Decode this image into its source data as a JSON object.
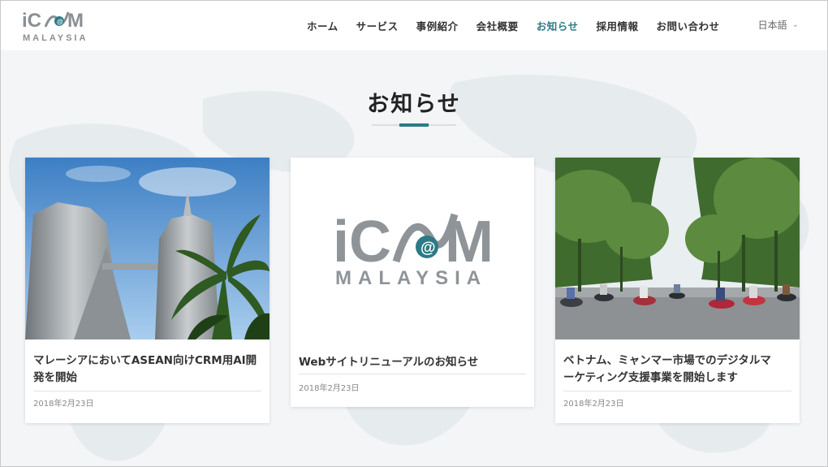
{
  "header": {
    "logo_text_top": "iC@M",
    "logo_text_bottom": "MALAYSIA",
    "nav": [
      {
        "label": "ホーム",
        "active": false
      },
      {
        "label": "サービス",
        "active": false
      },
      {
        "label": "事例紹介",
        "active": false
      },
      {
        "label": "会社概要",
        "active": false
      },
      {
        "label": "お知らせ",
        "active": true
      },
      {
        "label": "採用情報",
        "active": false
      },
      {
        "label": "お問い合わせ",
        "active": false
      }
    ],
    "language": "日本語"
  },
  "page": {
    "title": "お知らせ",
    "accent_color": "#2b7b87"
  },
  "cards": [
    {
      "title_line1": "マレーシアにおいてASEAN向けCRM用AI開",
      "title_line2": "発を開始",
      "date": "2018年2月23日",
      "image": "petronas-towers-photo"
    },
    {
      "title_line1": "Webサイトリニューアルのお知らせ",
      "title_line2": "",
      "date": "2018年2月23日",
      "image": "icam-malaysia-logo"
    },
    {
      "title_line1": "ベトナム、ミャンマー市場でのデジタルマ",
      "title_line2": "ーケティング支援事業を開始します",
      "date": "2018年2月23日",
      "image": "vietnam-street-motorbikes-photo"
    }
  ]
}
